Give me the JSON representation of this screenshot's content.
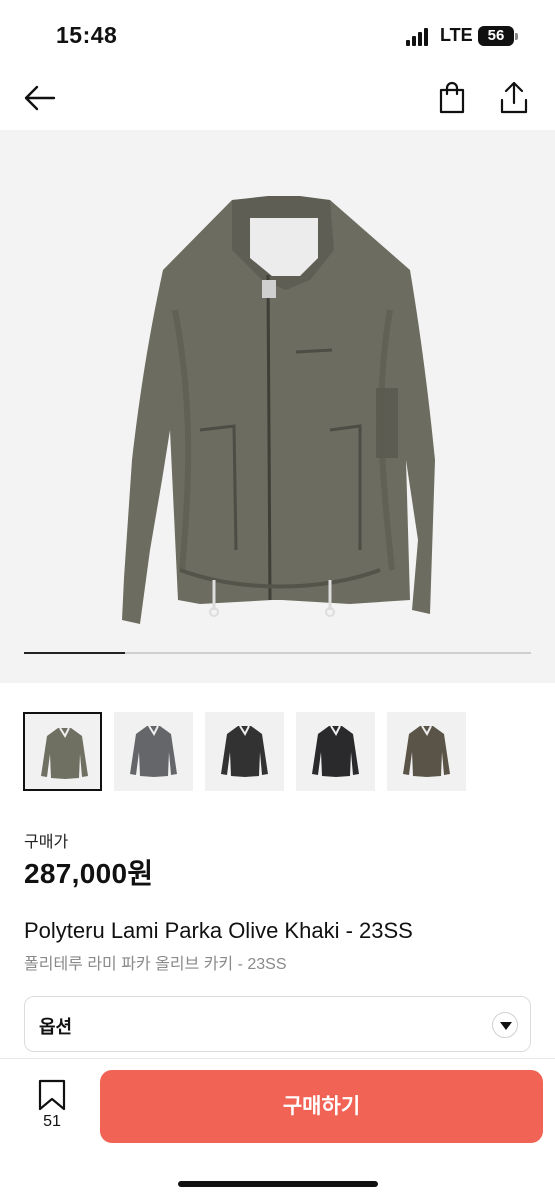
{
  "status": {
    "time": "15:48",
    "network": "LTE",
    "battery": "56"
  },
  "nav": {
    "back_icon": "arrow-left-icon",
    "bag_icon": "shopping-bag-icon",
    "share_icon": "share-icon"
  },
  "gallery": {
    "current_image": 1,
    "total_images": 5,
    "thumbnails": [
      {
        "color_name": "olive",
        "color": "#6f6f62"
      },
      {
        "color_name": "gray",
        "color": "#646669"
      },
      {
        "color_name": "charcoal",
        "color": "#323232"
      },
      {
        "color_name": "black",
        "color": "#2a2a2c"
      },
      {
        "color_name": "khaki-brown",
        "color": "#5a5448"
      }
    ]
  },
  "product": {
    "price_label": "구매가",
    "price": "287,000원",
    "title_en": "Polyteru Lami Parka Olive Khaki - 23SS",
    "title_ko": "폴리테루 라미 파카 올리브 카키 - 23SS"
  },
  "option": {
    "label": "옵션"
  },
  "bottom": {
    "bookmark_count": "51",
    "buy_label": "구매하기"
  },
  "colors": {
    "accent": "#f06355",
    "text": "#111111",
    "muted": "#8a8a8a"
  }
}
